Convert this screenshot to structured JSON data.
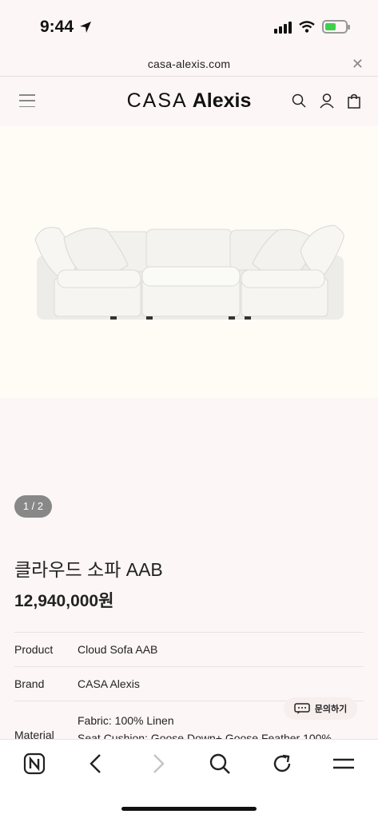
{
  "status_bar": {
    "time": "9:44"
  },
  "browser": {
    "url": "casa-alexis.com"
  },
  "site": {
    "logo_casa": "CASA",
    "logo_alexis": "Alexis"
  },
  "gallery": {
    "pager": "1 / 2"
  },
  "product": {
    "title": "클라우드 소파 AAB",
    "price": "12,940,000원",
    "info": [
      {
        "label": "Product",
        "value": "Cloud Sofa AAB"
      },
      {
        "label": "Brand",
        "value": "CASA Alexis"
      },
      {
        "label": "Material",
        "value_lines": [
          "Fabric: 100% Linen",
          "Seat Cushion: Goose Down+ Goose Feather 100%"
        ]
      }
    ]
  },
  "inquiry_button": {
    "label": "문의하기"
  }
}
